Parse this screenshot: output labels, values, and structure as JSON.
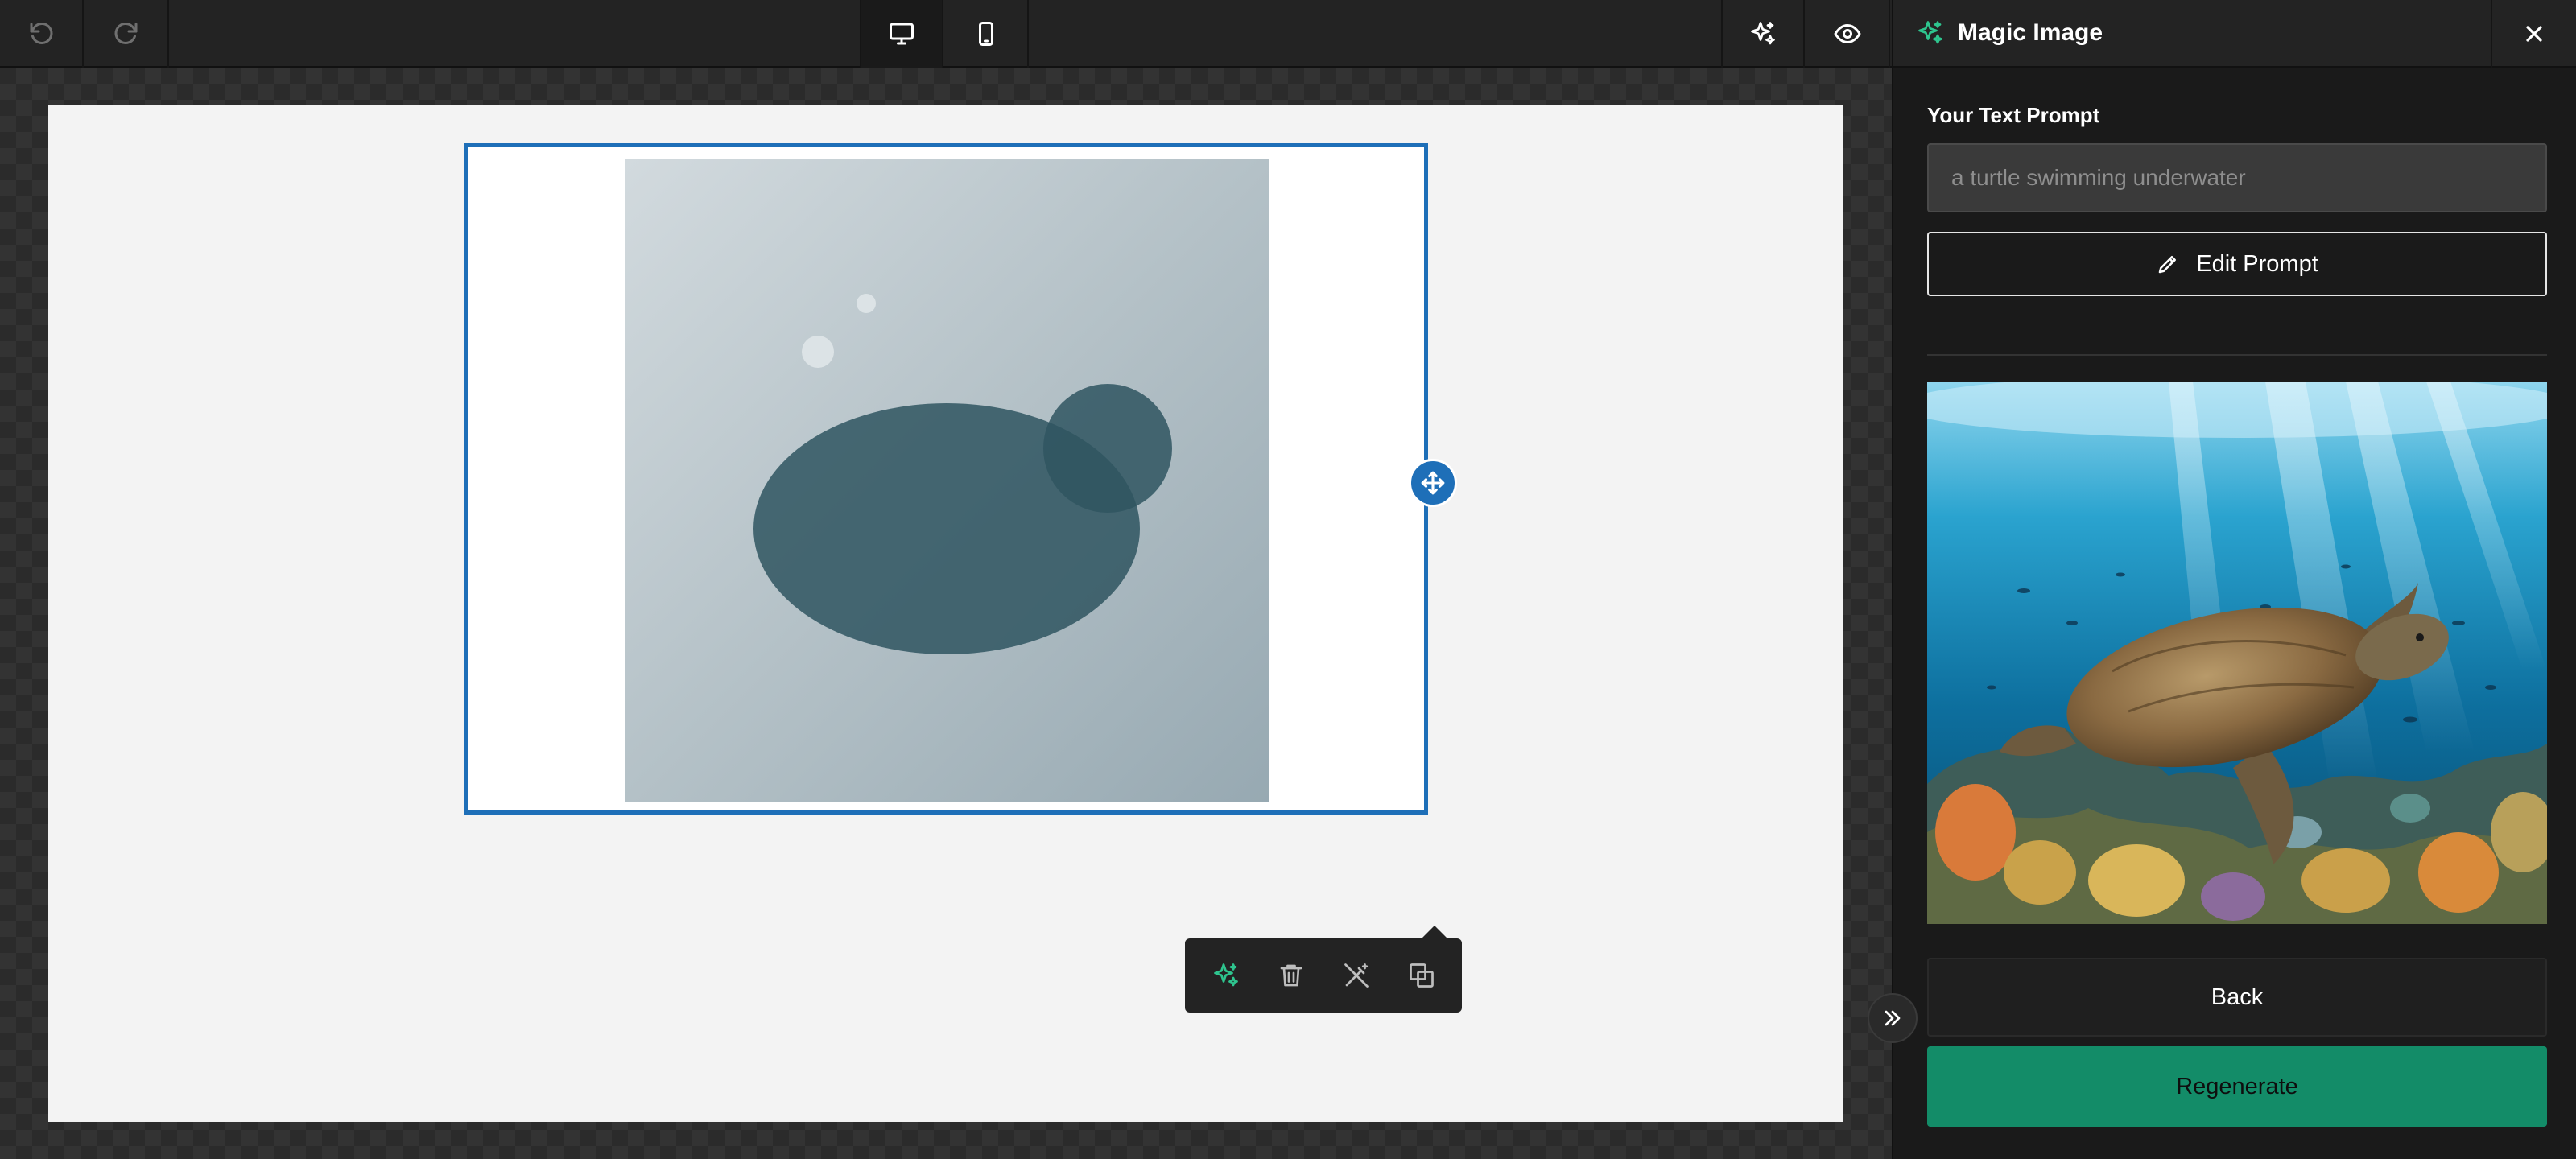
{
  "toolbar": {
    "undo_icon": "undo-icon",
    "redo_icon": "redo-icon",
    "desktop_icon": "desktop-icon",
    "mobile_icon": "mobile-icon",
    "magic_icon": "sparkle-icon",
    "preview_icon": "eye-icon"
  },
  "panel": {
    "title": "Magic Image",
    "prompt_label": "Your Text Prompt",
    "prompt_placeholder": "a turtle swimming underwater",
    "edit_prompt_label": "Edit Prompt",
    "back_label": "Back",
    "regenerate_label": "Regenerate"
  },
  "colors": {
    "accent_green": "#138c68",
    "selection_blue": "#1e6fb8",
    "sparkle_green": "#2ec48e"
  }
}
